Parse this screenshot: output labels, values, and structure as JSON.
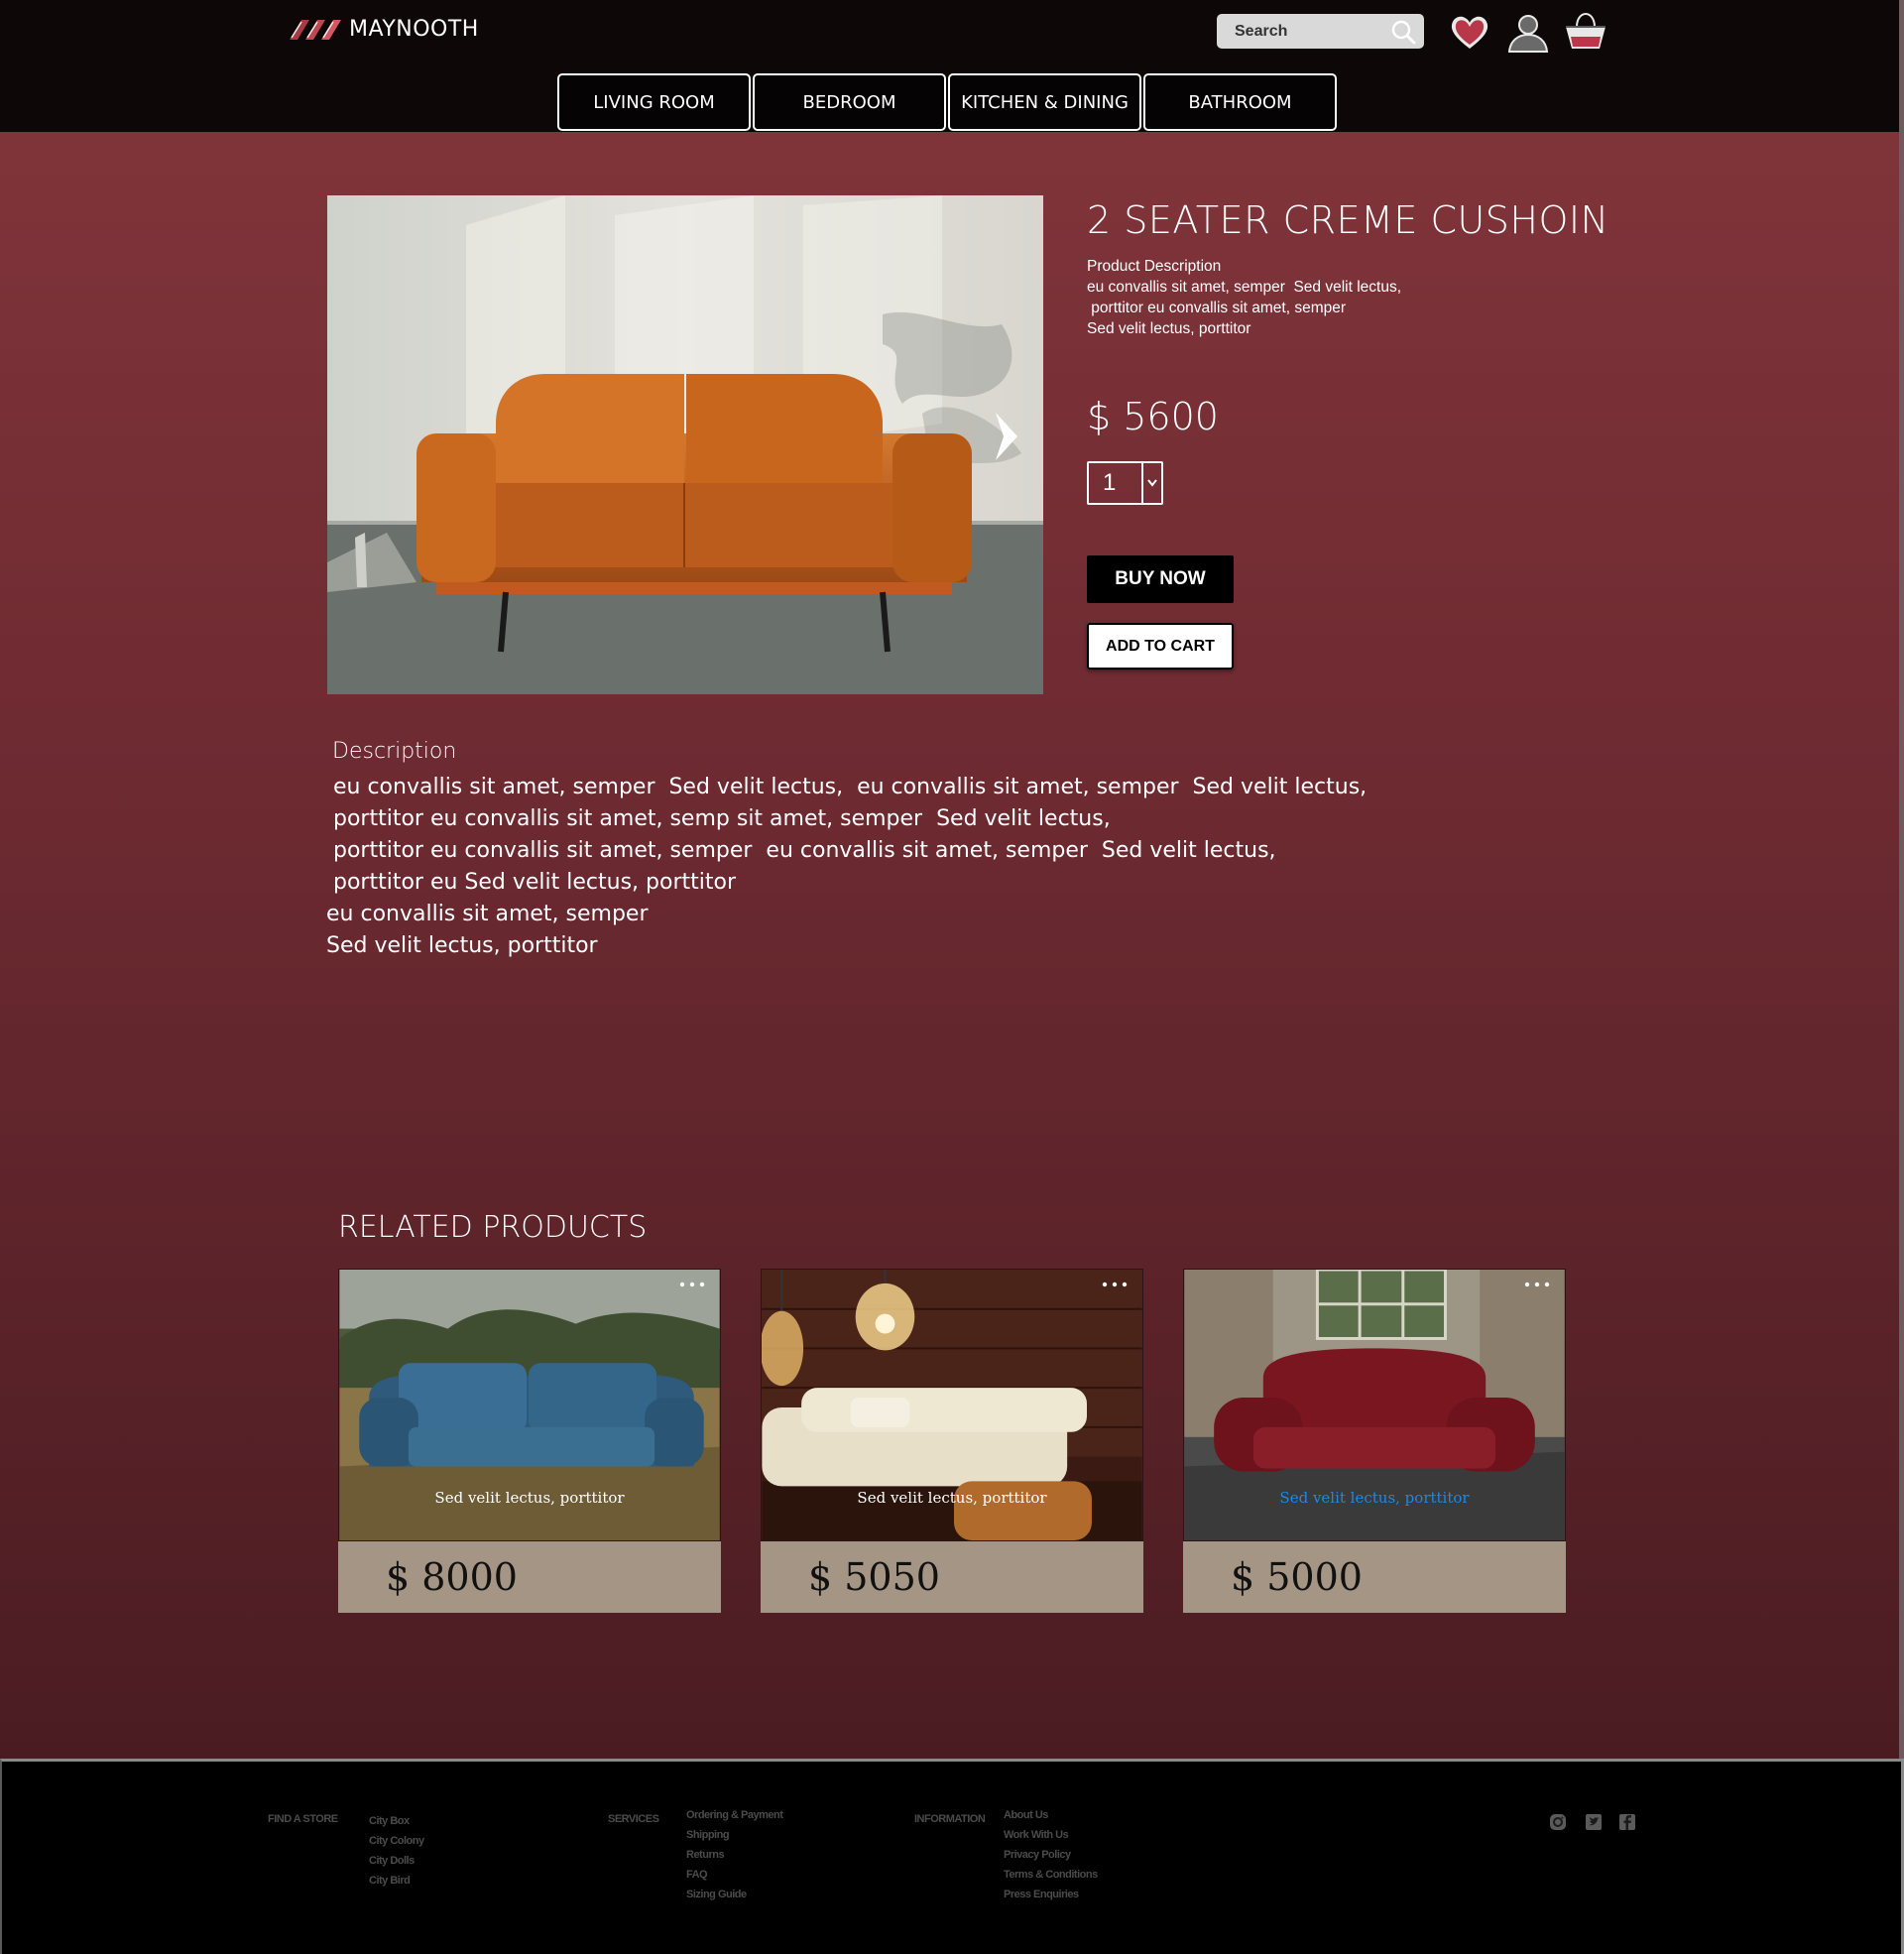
{
  "brand": {
    "name": "MAYNOOTH"
  },
  "search": {
    "placeholder": "Search"
  },
  "header_icons": [
    "search-icon",
    "heart-icon",
    "user-icon",
    "basket-icon"
  ],
  "categories": [
    "LIVING ROOM",
    "BEDROOM",
    "KITCHEN & DINING",
    "BATHROOM"
  ],
  "colors": {
    "accent": "#83363b",
    "header": "#0d0708",
    "price_panel": "#a59585"
  },
  "product": {
    "title": "2 SEATER CREME CUSHOIN",
    "short_desc_heading": "Product Description",
    "short_desc_lines": [
      "eu convallis sit amet, semper  Sed velit lectus,",
      " porttitor eu convallis sit amet, semper",
      "Sed velit lectus, porttitor"
    ],
    "price": "$ 5600",
    "quantity": "1",
    "buy_label": "BUY NOW",
    "cart_label": "ADD TO CART"
  },
  "gallery": {
    "slide_count": 4,
    "active_slide": 1
  },
  "description": {
    "heading": "Description",
    "lines": [
      " eu convallis sit amet, semper  Sed velit lectus,  eu convallis sit amet, semper  Sed velit lectus,",
      " porttitor eu convallis sit amet, semp sit amet, semper  Sed velit lectus,",
      " porttitor eu convallis sit amet, semper  eu convallis sit amet, semper  Sed velit lectus,",
      " porttitor eu Sed velit lectus, porttitor",
      "eu convallis sit amet, semper",
      "Sed velit lectus, porttitor"
    ]
  },
  "related": {
    "title": "RELATED PRODUCTS",
    "items": [
      {
        "caption": "Sed velit lectus, porttitor",
        "price": "$ 8000"
      },
      {
        "caption": "Sed velit lectus, porttitor",
        "price": "$ 5050"
      },
      {
        "caption": "Sed velit lectus, porttitor",
        "price": "$ 5000"
      }
    ]
  },
  "footer": {
    "find_store": {
      "heading": "FIND A STORE",
      "links": [
        "City Box",
        "City Colony",
        "City Dolls",
        "City Bird"
      ]
    },
    "services": {
      "heading": "SERVICES",
      "links": [
        "Ordering & Payment",
        "Shipping",
        "Returns",
        "FAQ",
        "Sizing Guide"
      ]
    },
    "information": {
      "heading": "INFORMATION",
      "links": [
        "About Us",
        "Work With Us",
        "Privacy Policy",
        "Terms & Conditions",
        "Press Enquiries"
      ]
    },
    "social_icons": [
      "instagram-icon",
      "twitter-icon",
      "facebook-icon"
    ]
  }
}
